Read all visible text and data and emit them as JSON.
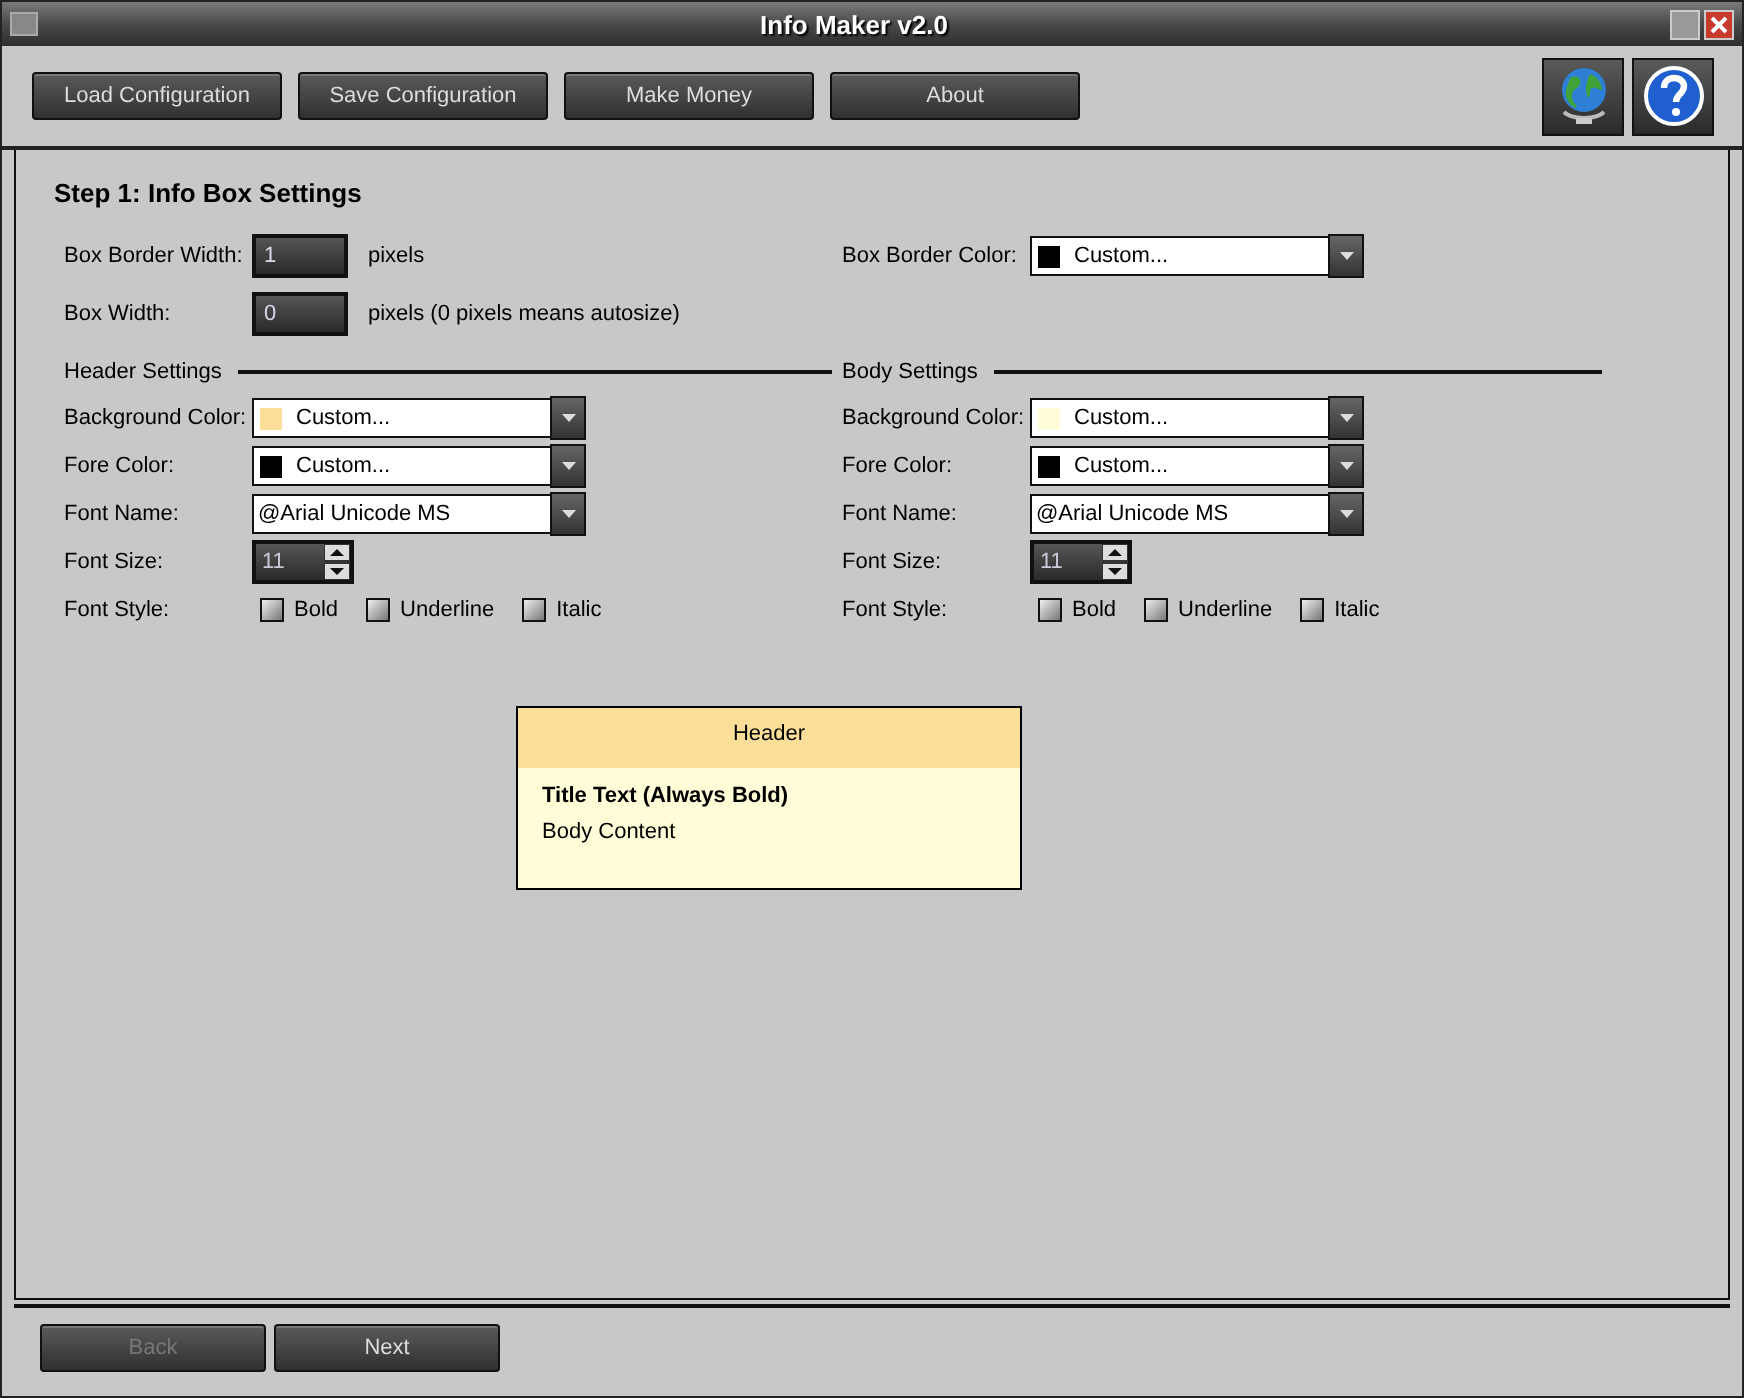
{
  "window": {
    "title": "Info Maker v2.0"
  },
  "toolbar": {
    "buttons": [
      "Load Configuration",
      "Save Configuration",
      "Make Money",
      "About"
    ]
  },
  "step_title": "Step 1: Info Box Settings",
  "box_border_width": {
    "label": "Box Border Width:",
    "value": "1",
    "unit": "pixels"
  },
  "box_width": {
    "label": "Box Width:",
    "value": "0",
    "unit": "pixels (0 pixels means autosize)"
  },
  "box_border_color": {
    "label": "Box Border Color:",
    "value": "Custom...",
    "color": "#000000"
  },
  "sections": [
    {
      "title": "Header Settings",
      "fields": [
        {
          "kind": "color",
          "label": "Background Color:",
          "value": "Custom...",
          "color": "#fbdf98"
        },
        {
          "kind": "color",
          "label": "Fore Color:",
          "value": "Custom...",
          "color": "#000000"
        },
        {
          "kind": "font",
          "label": "Font Name:",
          "value": "@Arial Unicode MS"
        },
        {
          "kind": "spin",
          "label": "Font Size:",
          "value": "11"
        },
        {
          "kind": "styles",
          "label": "Font Style:",
          "options": [
            {
              "label": "Bold",
              "checked": false
            },
            {
              "label": "Underline",
              "checked": false
            },
            {
              "label": "Italic",
              "checked": false
            }
          ]
        }
      ]
    },
    {
      "title": "Body Settings",
      "fields": [
        {
          "kind": "color",
          "label": "Background Color:",
          "value": "Custom...",
          "color": "#fffdd8"
        },
        {
          "kind": "color",
          "label": "Fore Color:",
          "value": "Custom...",
          "color": "#000000"
        },
        {
          "kind": "font",
          "label": "Font Name:",
          "value": "@Arial Unicode MS"
        },
        {
          "kind": "spin",
          "label": "Font Size:",
          "value": "11"
        },
        {
          "kind": "styles",
          "label": "Font Style:",
          "options": [
            {
              "label": "Bold",
              "checked": false
            },
            {
              "label": "Underline",
              "checked": false
            },
            {
              "label": "Italic",
              "checked": false
            }
          ]
        }
      ]
    }
  ],
  "preview": {
    "header": "Header",
    "title": "Title Text (Always Bold)",
    "body": "Body Content"
  },
  "footer": {
    "buttons": [
      {
        "label": "Back",
        "disabled": true
      },
      {
        "label": "Next",
        "disabled": false
      }
    ]
  }
}
